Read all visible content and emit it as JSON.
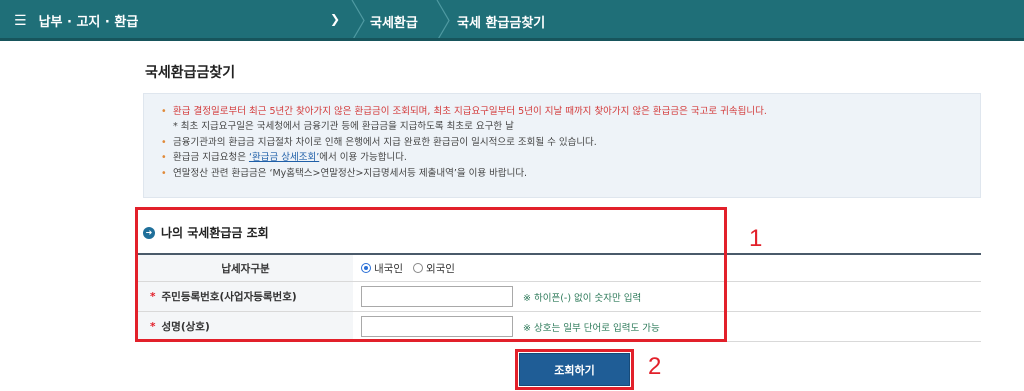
{
  "nav": {
    "menu_label": "납부 · 고지 · 환급",
    "crumbs": [
      "국세환급",
      "국세 환급금찾기"
    ]
  },
  "page_title": "국세환급금찾기",
  "notices": [
    "환급 결정일로부터 최근 5년간 찾아가지 않은 환급금이 조회되며, 최초 지급요구일부터 5년이 지날 때까지 찾아가지 않은 환급금은 국고로 귀속됩니다.",
    "* 최초 지급요구일은 국세청에서 금융기관 등에 환급금을 지급하도록 최초로 요구한 날",
    "금융기관과의 환급금 지급절차 차이로 인해 은행에서 지급 완료한 환급금이 일시적으로 조회될 수 있습니다.",
    "환급금 지급요청은 ",
    "‘환급금 상세조회’",
    "에서 이용 가능합니다.",
    "연말정산 관련 환급금은 ‘My홈택스>연말정산>지급명세서등 제출내역’을 이용 바랍니다."
  ],
  "section": {
    "title": "나의 국세환급금 조회",
    "taxpayer_type_label": "납세자구분",
    "taxpayer_type_options": [
      "내국인",
      "외국인"
    ],
    "taxpayer_type_selected": "내국인",
    "id_label": "주민등록번호(사업자등록번호)",
    "id_hint": "※ 하이픈(-) 없이 숫자만 입력",
    "id_value": "",
    "name_label": "성명(상호)",
    "name_hint": "※ 상호는 일부 단어로 입력도 가능",
    "name_value": "",
    "required_mark": "*"
  },
  "search_button": "조회하기",
  "annotations": [
    "1",
    "2"
  ],
  "colors": {
    "nav_bg": "#1f6f78",
    "highlight_red": "#e2202a",
    "button_blue": "#1f5d96",
    "notice_red": "#d33a3a"
  }
}
